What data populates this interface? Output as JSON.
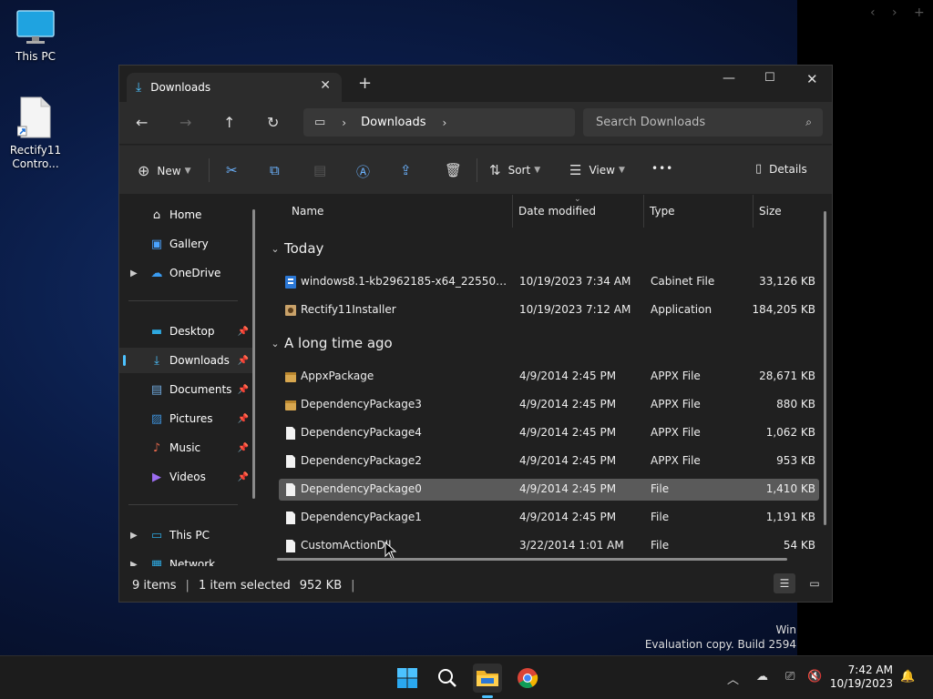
{
  "desktop": {
    "icons": [
      {
        "label": "This PC"
      },
      {
        "label": "Rectify11 Contro..."
      }
    ],
    "watermark": {
      "line1": "Win",
      "line2": "Evaluation copy. Build 2594"
    }
  },
  "window": {
    "tab_title": "Downloads",
    "address": {
      "crumb": "Downloads"
    },
    "search_placeholder": "Search Downloads",
    "toolbar": {
      "new_label": "New",
      "sort_label": "Sort",
      "view_label": "View",
      "more_label": "•••",
      "details_label": "Details"
    },
    "nav": [
      {
        "label": "Home"
      },
      {
        "label": "Gallery"
      },
      {
        "label": "OneDrive"
      },
      {
        "label": "Desktop"
      },
      {
        "label": "Downloads"
      },
      {
        "label": "Documents"
      },
      {
        "label": "Pictures"
      },
      {
        "label": "Music"
      },
      {
        "label": "Videos"
      },
      {
        "label": "This PC"
      },
      {
        "label": "Network"
      }
    ],
    "columns": {
      "name": "Name",
      "date": "Date modified",
      "type": "Type",
      "size": "Size"
    },
    "groups": {
      "today": "Today",
      "long_ago": "A long time ago"
    },
    "files": [
      {
        "name": "windows8.1-kb2962185-x64_225504b49f3...",
        "date": "10/19/2023 7:34 AM",
        "type": "Cabinet File",
        "size": "33,126 KB"
      },
      {
        "name": "Rectify11Installer",
        "date": "10/19/2023 7:12 AM",
        "type": "Application",
        "size": "184,205 KB"
      },
      {
        "name": "AppxPackage",
        "date": "4/9/2014 2:45 PM",
        "type": "APPX File",
        "size": "28,671 KB"
      },
      {
        "name": "DependencyPackage3",
        "date": "4/9/2014 2:45 PM",
        "type": "APPX File",
        "size": "880 KB"
      },
      {
        "name": "DependencyPackage4",
        "date": "4/9/2014 2:45 PM",
        "type": "APPX File",
        "size": "1,062 KB"
      },
      {
        "name": "DependencyPackage2",
        "date": "4/9/2014 2:45 PM",
        "type": "APPX File",
        "size": "953 KB"
      },
      {
        "name": "DependencyPackage0",
        "date": "4/9/2014 2:45 PM",
        "type": "File",
        "size": "1,410 KB"
      },
      {
        "name": "DependencyPackage1",
        "date": "4/9/2014 2:45 PM",
        "type": "File",
        "size": "1,191 KB"
      },
      {
        "name": "CustomActionDll",
        "date": "3/22/2014 1:01 AM",
        "type": "File",
        "size": "54 KB"
      }
    ],
    "status": {
      "items": "9 items",
      "selected": "1 item selected",
      "size": "952 KB",
      "sep": "|"
    }
  },
  "taskbar": {
    "time": "7:42 AM",
    "date": "10/19/2023"
  },
  "colors": {
    "accent": "#4cc2ff",
    "icon_blue": "#6cb3ff",
    "folder": "#f0b429"
  }
}
